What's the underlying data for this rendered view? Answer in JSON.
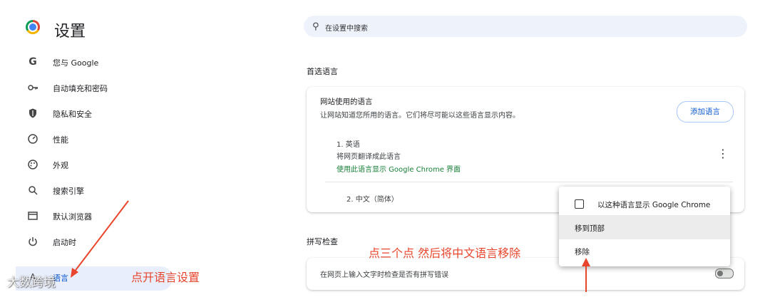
{
  "app": {
    "title": "设置"
  },
  "search": {
    "placeholder": "在设置中搜索"
  },
  "sidebar": {
    "items": [
      {
        "label": "您与 Google",
        "icon": "google-icon"
      },
      {
        "label": "自动填充和密码",
        "icon": "key-icon"
      },
      {
        "label": "隐私和安全",
        "icon": "shield-icon"
      },
      {
        "label": "性能",
        "icon": "speedometer-icon"
      },
      {
        "label": "外观",
        "icon": "palette-icon"
      },
      {
        "label": "搜索引擎",
        "icon": "search-icon"
      },
      {
        "label": "默认浏览器",
        "icon": "browser-window-icon"
      },
      {
        "label": "启动时",
        "icon": "power-icon"
      },
      {
        "label": "语言",
        "icon": "language-icon",
        "active": true
      }
    ]
  },
  "preferred_languages": {
    "section_title": "首选语言",
    "card_title": "网站使用的语言",
    "card_desc": "让网站知道您所用的语言。它们将尽可能以这些语言显示内容。",
    "add_button": "添加语言",
    "languages": [
      {
        "name": "1. 英语",
        "line2": "将网页翻译成此语言",
        "line3": "使用此语言显示 Google Chrome 界面"
      },
      {
        "name": "2. 中文（简体）"
      }
    ]
  },
  "context_menu": {
    "items": [
      {
        "label": "以这种语言显示 Google Chrome",
        "checked": false
      },
      {
        "label": "移到顶部",
        "highlighted": true
      },
      {
        "label": "移除"
      }
    ]
  },
  "spell_check": {
    "section_title": "拼写检查",
    "row_label": "在网页上输入文字时检查是否有拼写错误",
    "enabled": false
  },
  "annotations": {
    "left": "点开语言设置",
    "right": "点三个点 然后将中文语言移除",
    "color": "#e8452c"
  },
  "watermark": {
    "text": "大数跨境"
  }
}
